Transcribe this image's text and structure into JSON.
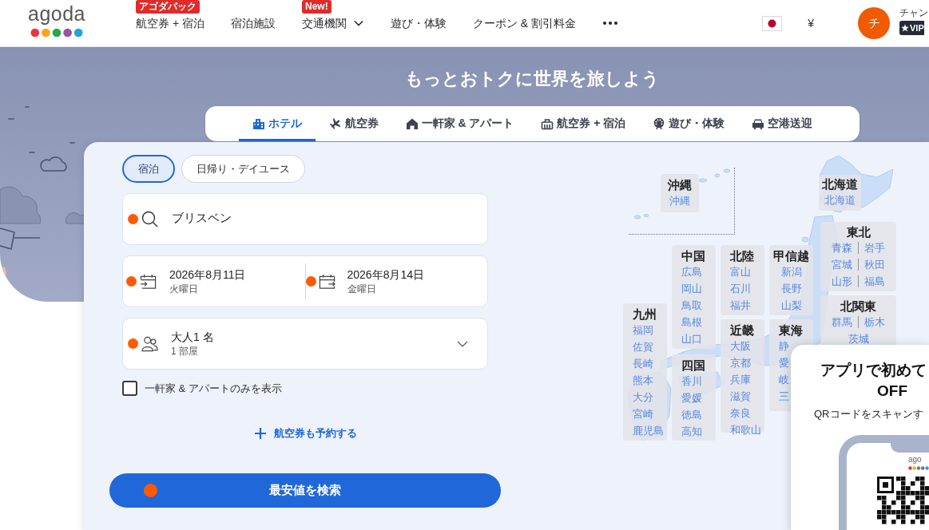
{
  "header": {
    "logo": "agoda",
    "nav": [
      {
        "label": "航空券 + 宿泊",
        "badge": "アゴダパック",
        "dropdown": false
      },
      {
        "label": "宿泊施設",
        "dropdown": false
      },
      {
        "label": "交通機関",
        "badge": "New!",
        "dropdown": true
      },
      {
        "label": "遊び・体験",
        "dropdown": false
      },
      {
        "label": "クーポン & 割引料金",
        "dropdown": false
      }
    ],
    "currency": "¥",
    "user": {
      "initial": "チ",
      "name": "チャン",
      "tier": "VIP"
    }
  },
  "hero": {
    "title": "もっとおトクに世界を旅しよう"
  },
  "product_tabs": [
    {
      "label": "ホテル",
      "kind": "hotel",
      "selected": true
    },
    {
      "label": "航空券",
      "kind": "flight",
      "selected": false
    },
    {
      "label": "一軒家 & アパート",
      "kind": "home",
      "selected": false
    },
    {
      "label": "航空券 + 宿泊",
      "kind": "package",
      "selected": false
    },
    {
      "label": "遊び・体験",
      "kind": "activity",
      "selected": false
    },
    {
      "label": "空港送迎",
      "kind": "transfer",
      "selected": false
    }
  ],
  "search_form": {
    "stay_types": [
      {
        "label": "宿泊",
        "selected": true
      },
      {
        "label": "日帰り・デイユース",
        "selected": false
      }
    ],
    "destination": {
      "value": "ブリスベン"
    },
    "check_in": {
      "date": "2026年8月11日",
      "weekday": "火曜日"
    },
    "check_out": {
      "date": "2026年8月14日",
      "weekday": "金曜日"
    },
    "guests": {
      "value": "大人1 名",
      "rooms": "1 部屋"
    },
    "homes_only": {
      "label": "一軒家 & アパートのみを表示",
      "checked": false
    },
    "add_flight": "航空券も予約する",
    "search_button": "最安値を検索"
  },
  "destination_map": {
    "regions": [
      {
        "name": "沖縄",
        "rows": [
          [
            "沖縄"
          ]
        ]
      },
      {
        "name": "北海道",
        "rows": [
          [
            "北海道"
          ]
        ]
      },
      {
        "name": "東北",
        "rows": [
          [
            "青森",
            "岩手"
          ],
          [
            "宮城",
            "秋田"
          ],
          [
            "山形",
            "福島"
          ]
        ]
      },
      {
        "name": "中国",
        "rows": [
          [
            "広島"
          ],
          [
            "岡山"
          ],
          [
            "鳥取"
          ],
          [
            "島根"
          ],
          [
            "山口"
          ]
        ]
      },
      {
        "name": "北陸",
        "rows": [
          [
            "富山"
          ],
          [
            "石川"
          ],
          [
            "福井"
          ]
        ]
      },
      {
        "name": "甲信越",
        "rows": [
          [
            "新潟"
          ],
          [
            "長野"
          ],
          [
            "山梨"
          ]
        ]
      },
      {
        "name": "北関東",
        "rows": [
          [
            "群馬",
            "栃木"
          ],
          [
            "茨城"
          ]
        ]
      },
      {
        "name": "九州",
        "rows": [
          [
            "福岡"
          ],
          [
            "佐賀"
          ],
          [
            "長崎"
          ],
          [
            "熊本"
          ],
          [
            "大分"
          ],
          [
            "宮崎"
          ],
          [
            "鹿児島"
          ]
        ]
      },
      {
        "name": "近畿",
        "rows": [
          [
            "大阪"
          ],
          [
            "京都"
          ],
          [
            "兵庫"
          ],
          [
            "滋賀"
          ],
          [
            "奈良"
          ],
          [
            "和歌山"
          ]
        ]
      },
      {
        "name": "東海",
        "rows": [
          [
            "静"
          ],
          [
            "愛"
          ],
          [
            "岐"
          ],
          [
            "三"
          ]
        ]
      },
      {
        "name": "四国",
        "rows": [
          [
            "香川"
          ],
          [
            "愛媛"
          ],
          [
            "徳島"
          ],
          [
            "高知"
          ]
        ]
      }
    ]
  },
  "app_promo": {
    "title_lines": [
      "アプリで初めて",
      "OFF"
    ],
    "subtitle": "QRコードをスキャンす",
    "phone_logo": "ago"
  }
}
